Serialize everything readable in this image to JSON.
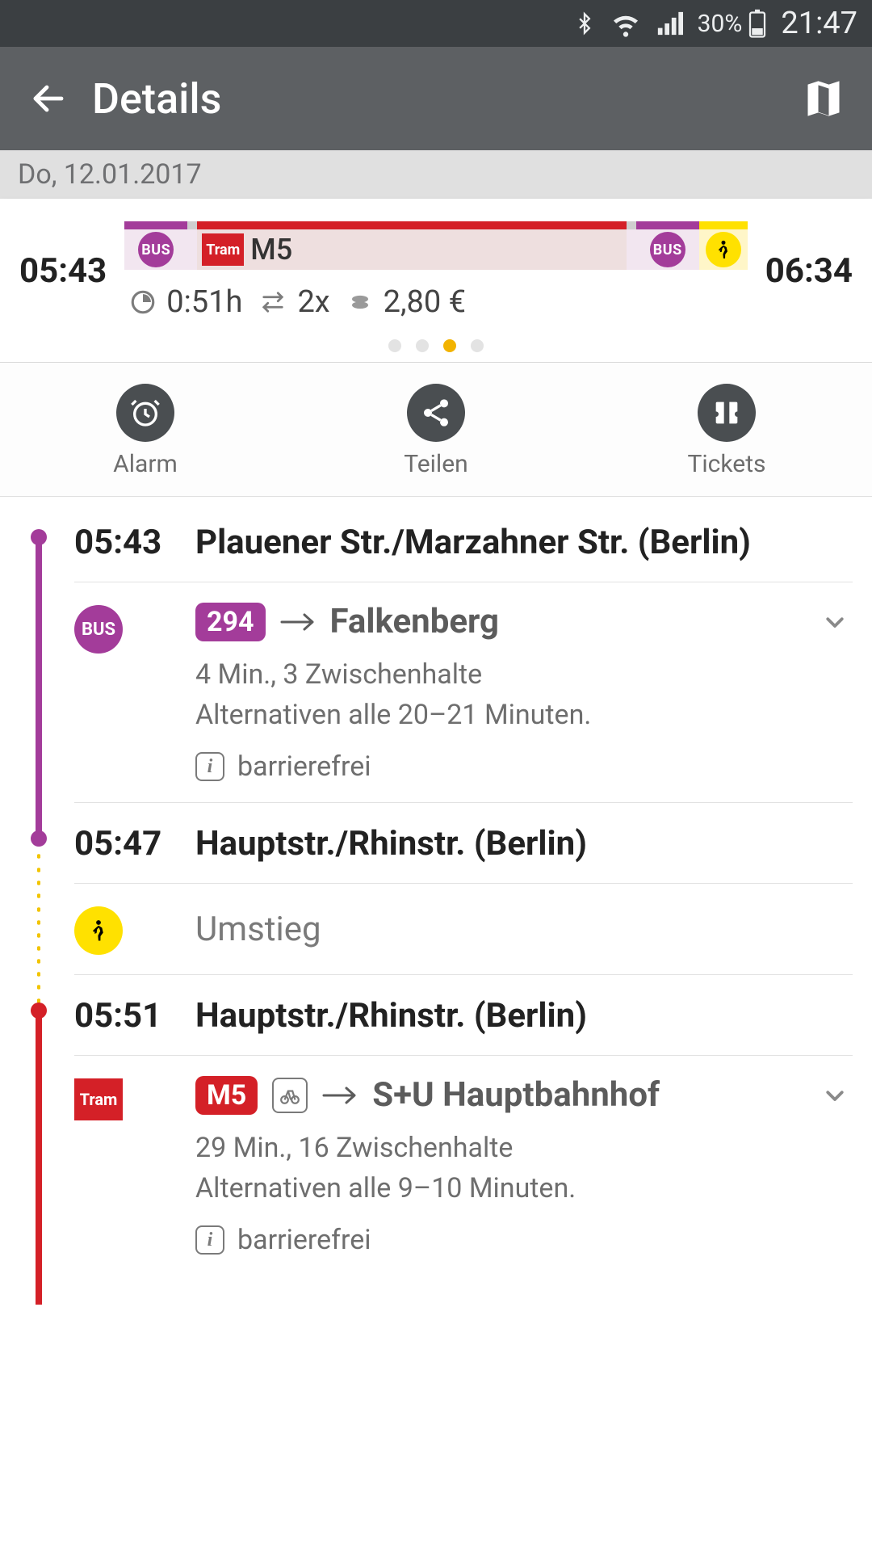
{
  "status": {
    "battery": "30%",
    "clock": "21:47"
  },
  "appbar": {
    "title": "Details"
  },
  "date": "Do, 12.01.2017",
  "summary": {
    "depart": "05:43",
    "arrive": "06:34",
    "tram_line": "M5",
    "duration": "0:51h",
    "changes": "2x",
    "price": "2,80 €",
    "bus_label": "BUS",
    "tram_label": "Tram",
    "pager_active_index": 2,
    "pager_count": 4
  },
  "actions": {
    "alarm": "Alarm",
    "share": "Teilen",
    "tickets": "Tickets"
  },
  "steps": [
    {
      "time": "05:43",
      "stop": "Plauener Str./Marzahner Str. (Berlin)",
      "leg": {
        "mode": "bus",
        "line": "294",
        "dest": "Falkenberg",
        "sub1": "4 Min., 3 Zwischenhalte",
        "sub2": "Alternativen alle 20–21 Minuten.",
        "access": "barrierefrei"
      }
    },
    {
      "time": "05:47",
      "stop": "Hauptstr./Rhinstr. (Berlin)",
      "leg": {
        "mode": "walk",
        "label": "Umstieg"
      }
    },
    {
      "time": "05:51",
      "stop": "Hauptstr./Rhinstr. (Berlin)",
      "leg": {
        "mode": "tram",
        "line": "M5",
        "dest": "S+U Hauptbahnhof",
        "sub1": "29 Min., 16 Zwischenhalte",
        "sub2": "Alternativen alle 9–10 Minuten.",
        "access": "barrierefrei"
      }
    }
  ]
}
